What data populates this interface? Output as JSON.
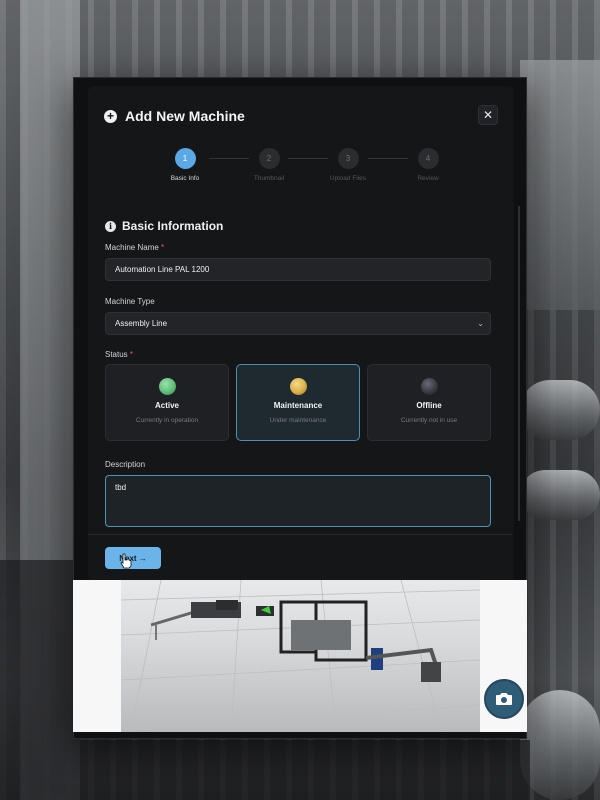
{
  "modal": {
    "title": "Add New Machine",
    "close_symbol": "✕"
  },
  "stepper": {
    "steps": [
      {
        "number": "1",
        "label": "Basic Info",
        "active": true
      },
      {
        "number": "2",
        "label": "Thumbnail",
        "active": false
      },
      {
        "number": "3",
        "label": "Upload Files",
        "active": false
      },
      {
        "number": "4",
        "label": "Review",
        "active": false
      }
    ]
  },
  "section": {
    "title": "Basic Information",
    "info_symbol": "i"
  },
  "form": {
    "machine_name_label": "Machine Name",
    "machine_name_value": "Automation Line PAL 1200",
    "required_mark": "*",
    "machine_type_label": "Machine Type",
    "machine_type_value": "Assembly Line",
    "status_label": "Status",
    "status_options": [
      {
        "name": "Active",
        "desc": "Currently in operation",
        "color": "#5fbf7a",
        "selected": false
      },
      {
        "name": "Maintenance",
        "desc": "Under maintenance",
        "color": "#d9b14a",
        "selected": true
      },
      {
        "name": "Offline",
        "desc": "Currently not in use",
        "color": "#3a3a44",
        "selected": false
      }
    ],
    "description_label": "Description",
    "description_value": "tbd"
  },
  "actions": {
    "next_label": "Next →"
  },
  "colors": {
    "accent": "#5aa9e6",
    "modal_bg": "#0f1012",
    "camera_button": "#2f5c77"
  },
  "icons": {
    "add": "plus-circle-icon",
    "close": "close-icon",
    "info": "info-icon",
    "chevron": "chevron-down-icon",
    "camera": "camera-icon",
    "cursor": "hand-pointer-icon"
  }
}
